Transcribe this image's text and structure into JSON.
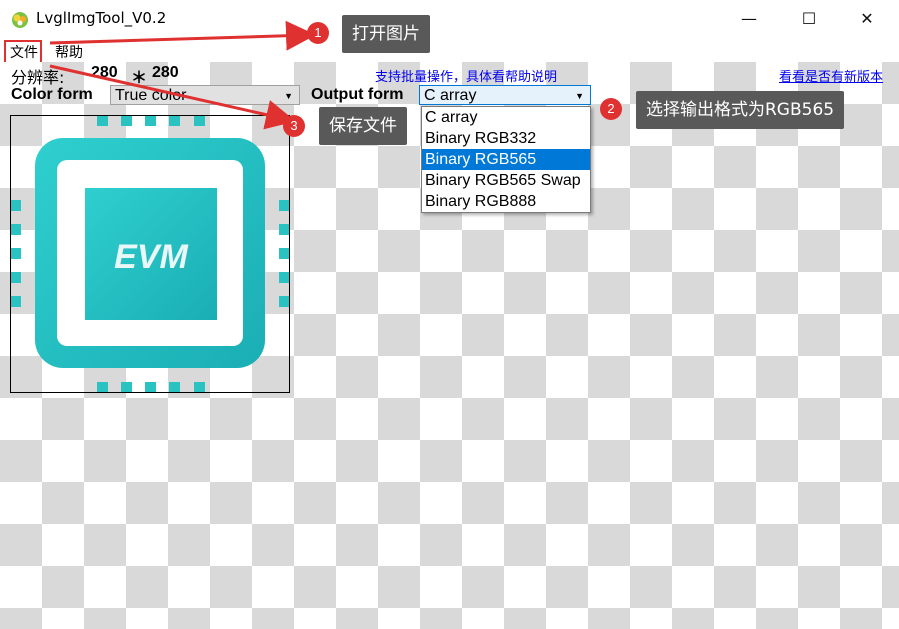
{
  "window": {
    "title": "LvglImgTool_V0.2",
    "minimize": "—",
    "maximize": "☐",
    "close": "✕"
  },
  "menu": {
    "file": "文件",
    "help": "帮助"
  },
  "resolution": {
    "label": "分辨率:",
    "width": "280",
    "times": "＊",
    "height": "280"
  },
  "links": {
    "batch": "支持批量操作，具体看帮助说明",
    "update": "看看是否有新版本"
  },
  "color_form": {
    "label": "Color form",
    "value": "True color"
  },
  "output_form": {
    "label": "Output form",
    "value": "C array",
    "options": [
      "C array",
      "Binary RGB332",
      "Binary RGB565",
      "Binary RGB565 Swap",
      "Binary RGB888"
    ],
    "highlighted": "Binary RGB565"
  },
  "preview": {
    "logo_text": "EVM",
    "accent": "#26c6c6"
  },
  "annotations": [
    {
      "num": "1",
      "text": "打开图片"
    },
    {
      "num": "2",
      "text": "选择输出格式为RGB565"
    },
    {
      "num": "3",
      "text": "保存文件"
    }
  ],
  "colors": {
    "arrow": "#e03131",
    "callout_bg": "#595959",
    "selection": "#0078d7"
  }
}
